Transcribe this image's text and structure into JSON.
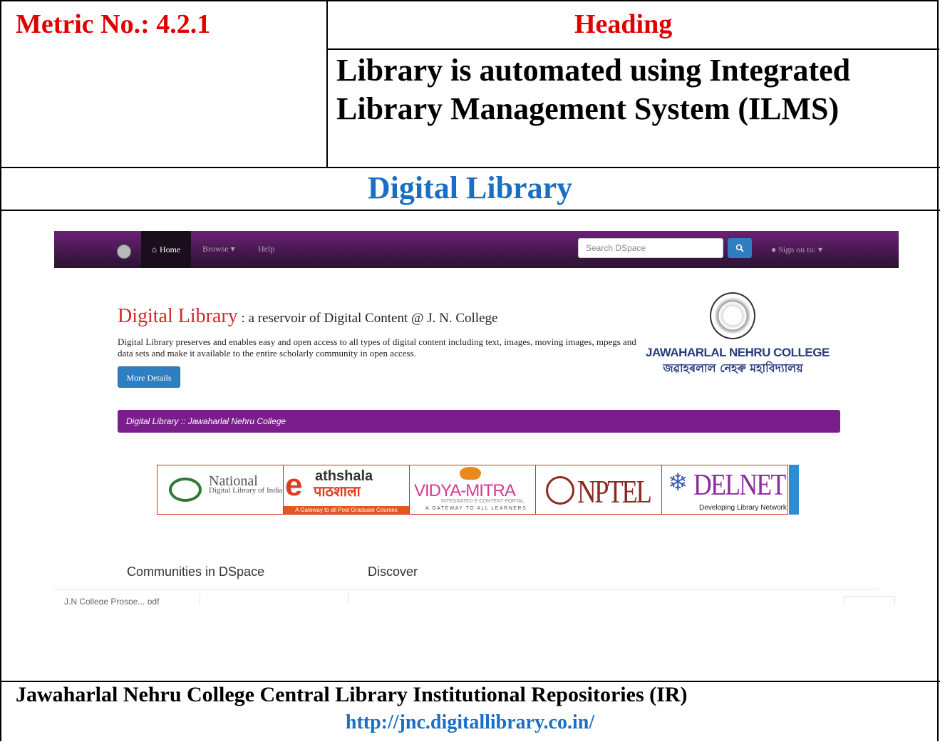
{
  "header": {
    "metric": "Metric No.: 4.2.1",
    "heading_label": "Heading",
    "heading_text": "Library is automated using Integrated Library Management System (ILMS)"
  },
  "section_title": "Digital Library",
  "screenshot": {
    "navbar": {
      "home": "Home",
      "browse": "Browse",
      "help": "Help",
      "search_placeholder": "Search DSpace",
      "sign_on": "Sign on to:"
    },
    "jumbotron": {
      "title": "Digital Library",
      "subtitle": " : a reservoir of Digital Content @ J. N. College",
      "text": "Digital Library preserves and enables easy and open access to all types of digital content including text, images, moving images, mpegs and data sets and make it available to the entire scholarly community in open access.",
      "button": "More Details"
    },
    "logo": {
      "name_en": "JAWAHARLAL NEHRU COLLEGE",
      "name_bn": "জৱাহৰলাল নেহৰু মহাবিদ্যালয়"
    },
    "bar_text": "Digital Library :: Jawaharlal Nehru College",
    "banners": {
      "ndl_name": "National",
      "ndl_sub": "Digital Library of India",
      "path_e": "e",
      "path_name": "athshala",
      "path_hindi": "पाठशाला",
      "path_tagline": "A Gateway to all Post Graduate Courses",
      "vm_name": "VIDYA-MITRA",
      "vm_sub1": "INTEGRATED E-CONTENT PORTAL",
      "vm_sub2": "A GATEWAY TO ALL LEARNERS",
      "nptel": "NPTEL",
      "delnet": "DELNET",
      "delnet_sub": "Developing Library Network"
    },
    "tabs": {
      "communities": "Communities in DSpace",
      "discover": "Discover"
    },
    "cut_item": "J.N College Prospe... pdf"
  },
  "footer": {
    "caption": "Jawaharlal Nehru College Central Library Institutional Repositories (IR)",
    "url": "http://jnc.digitallibrary.co.in/"
  }
}
